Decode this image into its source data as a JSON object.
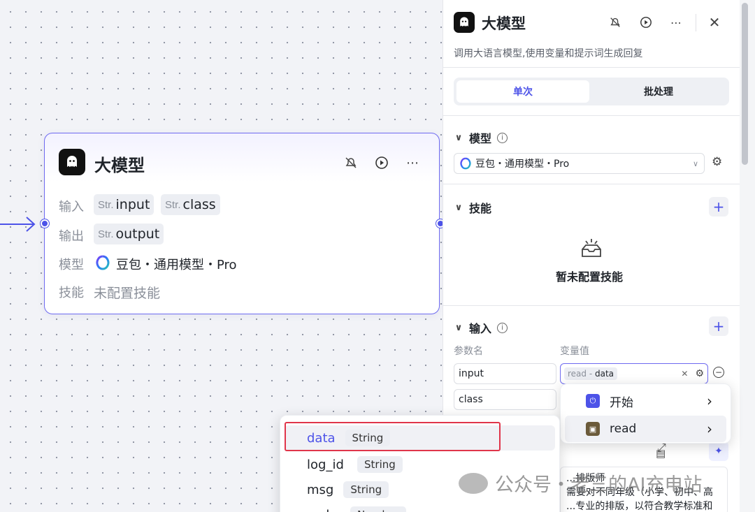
{
  "node": {
    "title": "大模型",
    "input_label": "输入",
    "output_label": "输出",
    "model_label": "模型",
    "skill_label": "技能",
    "str_prefix": "Str.",
    "inputs": [
      "input",
      "class"
    ],
    "outputs": [
      "output"
    ],
    "model_name": "豆包・通用模型・Pro",
    "skill_value": "未配置技能"
  },
  "panel": {
    "title": "大模型",
    "description": "调用大语言模型,使用变量和提示词生成回复",
    "tabs": [
      "单次",
      "批处理"
    ],
    "active_tab": "单次",
    "model_section": "模型",
    "model_value": "豆包・通用模型・Pro",
    "skill_section": "技能",
    "skill_empty": "暂未配置技能",
    "input_section": "输入",
    "param_name_header": "参数名",
    "param_value_header": "变量值",
    "params": [
      {
        "name": "input",
        "value_source": "read",
        "value_sep": " - ",
        "value_field": "data"
      },
      {
        "name": "class"
      }
    ],
    "prompt_text": "...排版师\n需要对不同年级（小学、初中、高\n...专业的排版，以符合教学标准和提"
  },
  "source_menu": {
    "items": [
      {
        "label": "开始",
        "icon": "start-node-icon"
      },
      {
        "label": "read",
        "icon": "read-plugin-icon"
      }
    ]
  },
  "var_menu": {
    "items": [
      {
        "name": "data",
        "type": "String"
      },
      {
        "name": "log_id",
        "type": "String"
      },
      {
        "name": "msg",
        "type": "String"
      },
      {
        "name": "code",
        "type": "Number"
      }
    ]
  },
  "watermark": "公众号・老三的AI充电站",
  "colors": {
    "accent": "#4d53e8",
    "node_border": "#6e6af0",
    "highlight_red": "#e0354a"
  }
}
